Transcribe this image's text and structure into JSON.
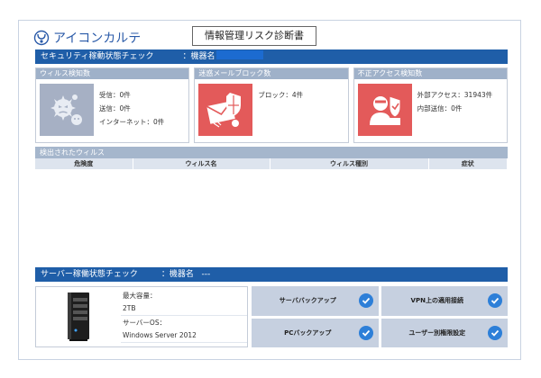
{
  "header": {
    "brand": "アイコンカルテ",
    "document_title": "情報管理リスク診断書"
  },
  "security_check": {
    "title": "セキュリティ稼動状態チェック",
    "device_label": "：機器名"
  },
  "panels": [
    {
      "title": "ウィルス検知数",
      "icon": "virus-icon",
      "lines": [
        "受信：0件",
        "送信：0件",
        "インターネット：0件"
      ]
    },
    {
      "title": "迷惑メールブロック数",
      "icon": "spam-mail-icon",
      "lines": [
        "ブロック：4件"
      ]
    },
    {
      "title": "不正アクセス検知数",
      "icon": "intrusion-icon",
      "lines": [
        "外部アクセス：31943件",
        "内部送信：0件"
      ]
    }
  ],
  "virus_list": {
    "title": "検出されたウィルス",
    "columns": [
      "危険度",
      "ウィルス名",
      "ウィルス種別",
      "症状"
    ]
  },
  "server_check": {
    "title": "サーバー稼働状態チェック",
    "device_label": "：機器名",
    "device_value": "---",
    "capacity_label": "最大容量：",
    "capacity_value": "2TB",
    "os_label": "サーバーOS：",
    "os_value": "Windows Server 2012",
    "checks": [
      {
        "label": "サーババックアップ",
        "status": "ok"
      },
      {
        "label": "VPN上の適用接続",
        "status": "ok"
      },
      {
        "label": "PCバックアップ",
        "status": "ok"
      },
      {
        "label": "ユーザー別権限設定",
        "status": "ok"
      }
    ]
  },
  "colors": {
    "section_bar": "#1f5ea8",
    "panel_header": "#9fb1c9",
    "alert_red": "#e35a5a",
    "check_blue": "#2d7fd8"
  }
}
